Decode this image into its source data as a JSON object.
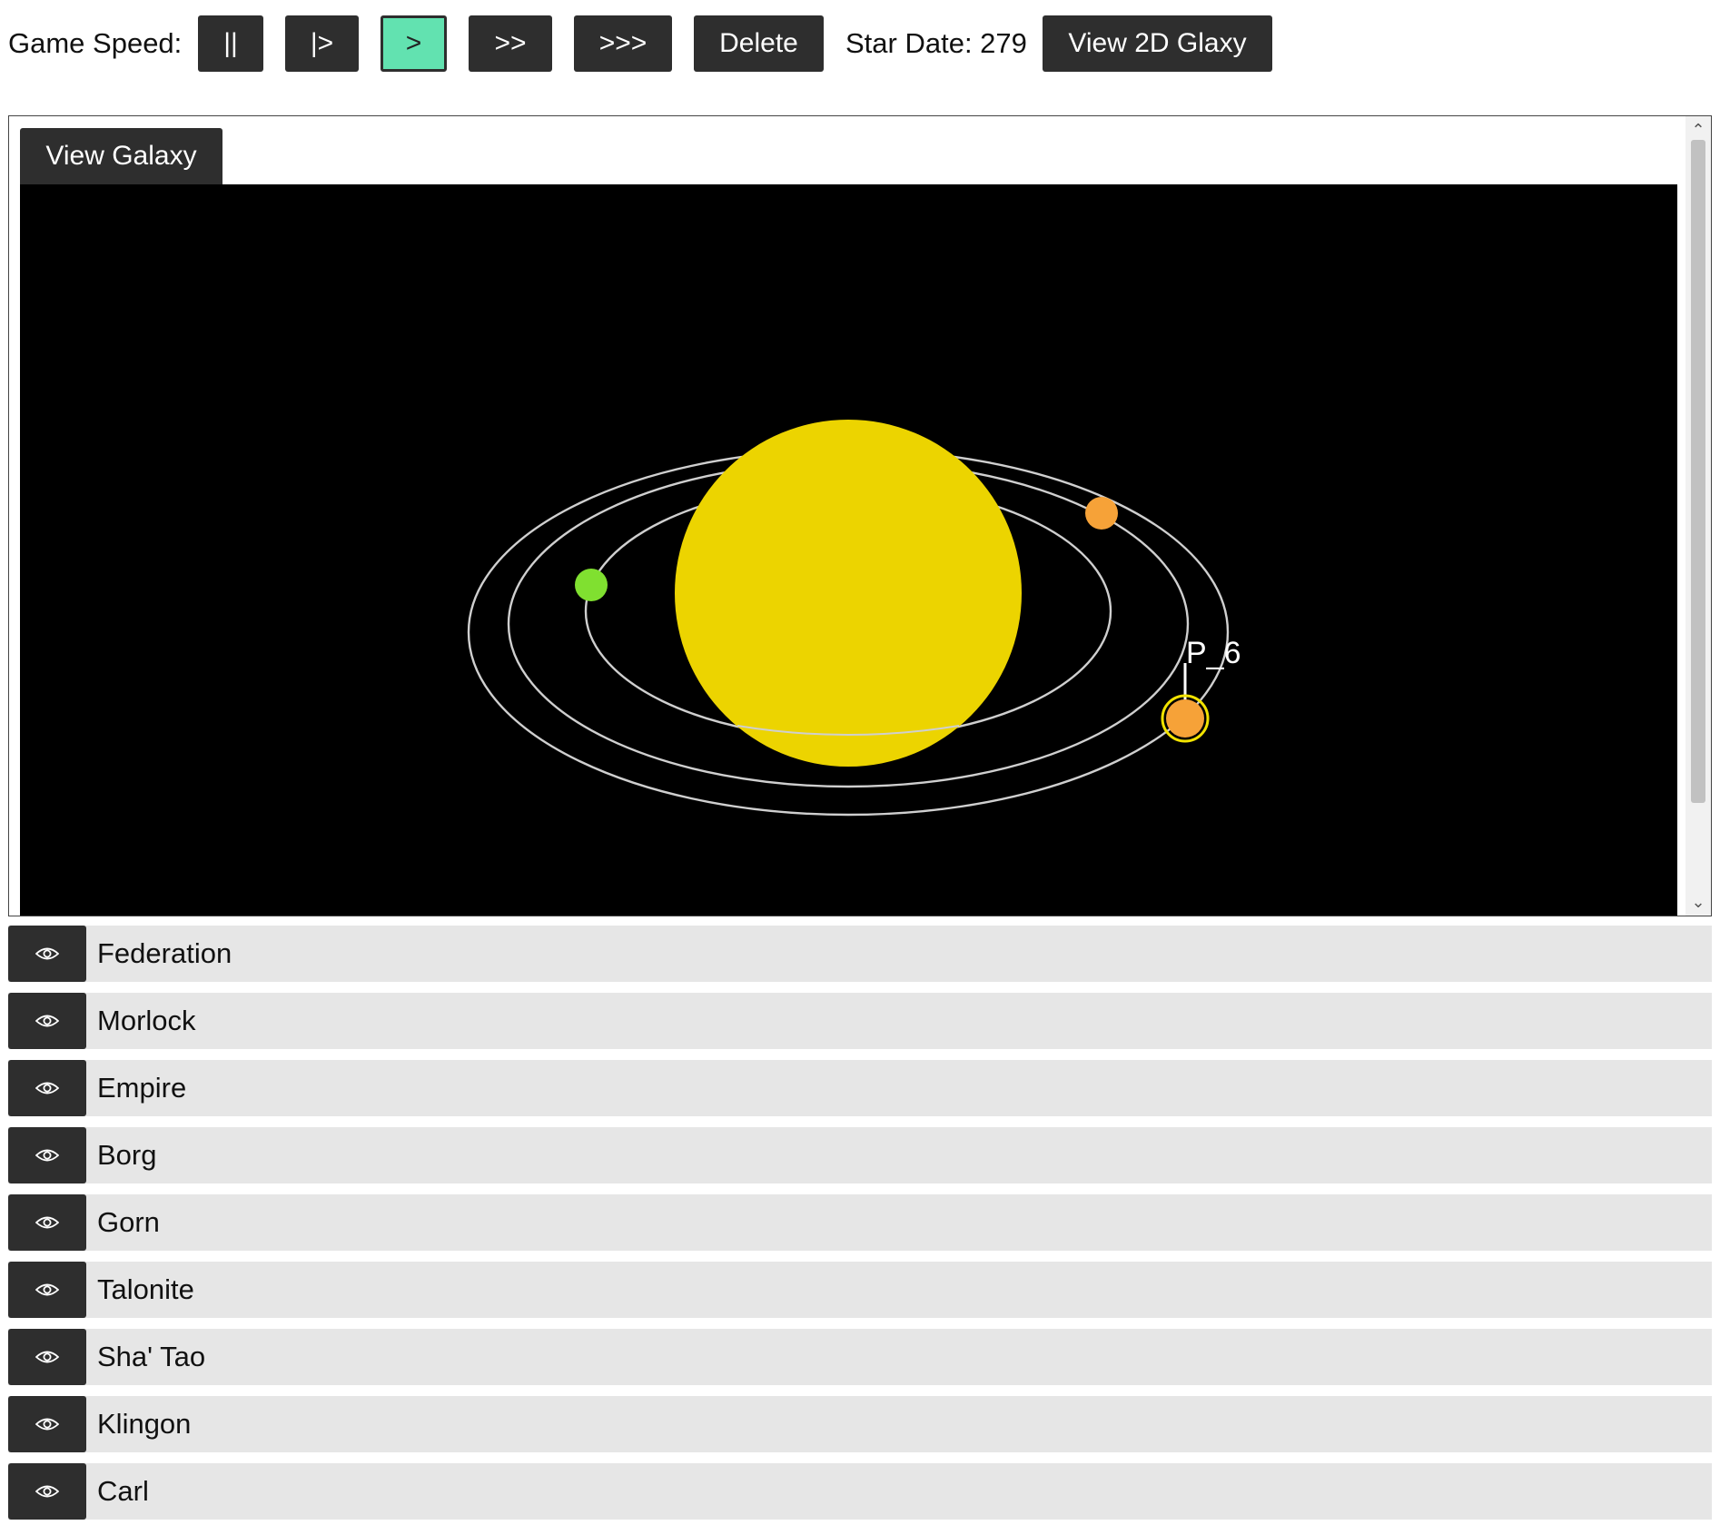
{
  "toolbar": {
    "speed_label": "Game Speed:",
    "speed_buttons": [
      {
        "label": "||",
        "active": false
      },
      {
        "label": "|>",
        "active": false
      },
      {
        "label": ">",
        "active": true
      },
      {
        "label": ">>",
        "active": false
      },
      {
        "label": ">>>",
        "active": false
      }
    ],
    "delete_label": "Delete",
    "star_date_label": "Star Date: 279",
    "view_2d_label": "View 2D Glaxy"
  },
  "viewport": {
    "view_galaxy_label": "View Galaxy",
    "selected_planet_label": "P_6",
    "colors": {
      "background": "#000000",
      "star": "#ecd400",
      "orbit": "#cfcfcf",
      "planet_green": "#80e030",
      "planet_orange": "#f6a238",
      "selection_ring": "#f2e300"
    },
    "planets": [
      {
        "name": "green-planet",
        "color": "planet_green",
        "selected": false
      },
      {
        "name": "orange-planet",
        "color": "planet_orange",
        "selected": false
      },
      {
        "name": "selected-planet",
        "color": "planet_orange",
        "selected": true
      }
    ]
  },
  "factions": [
    {
      "name": "Federation",
      "icon": "eye-icon"
    },
    {
      "name": "Morlock",
      "icon": "eye-icon"
    },
    {
      "name": "Empire",
      "icon": "eye-icon"
    },
    {
      "name": "Borg",
      "icon": "eye-icon"
    },
    {
      "name": "Gorn",
      "icon": "eye-icon"
    },
    {
      "name": "Talonite",
      "icon": "eye-icon"
    },
    {
      "name": "Sha' Tao",
      "icon": "eye-icon"
    },
    {
      "name": "Klingon",
      "icon": "eye-icon"
    },
    {
      "name": "Carl",
      "icon": "eye-icon"
    }
  ]
}
